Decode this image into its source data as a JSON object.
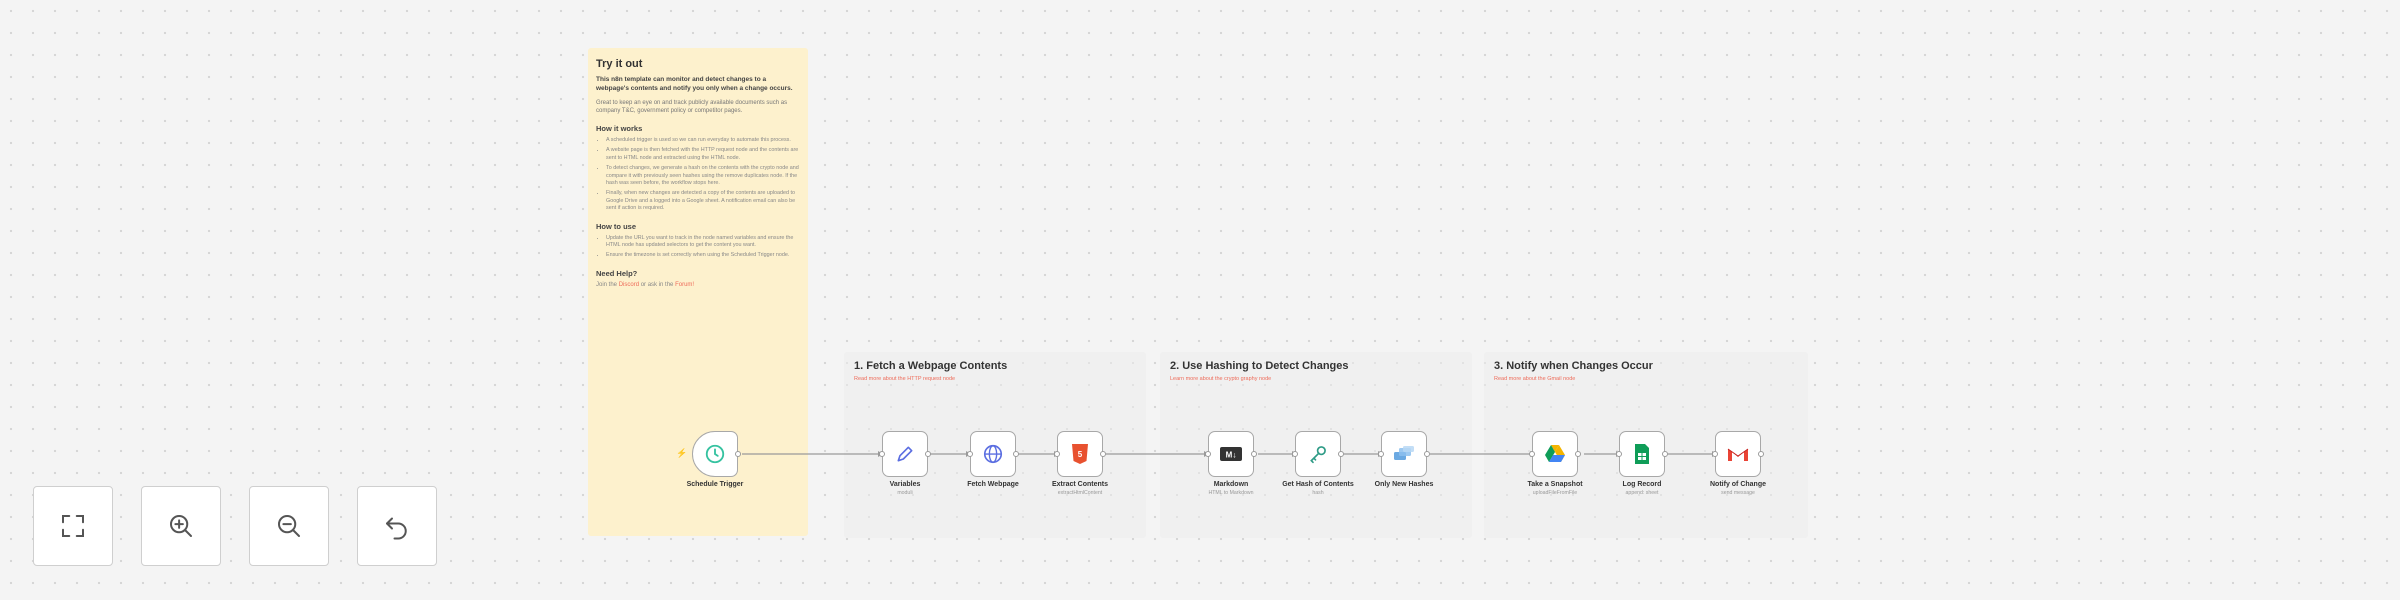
{
  "note": {
    "title": "Try it out",
    "lead": "This n8n template can monitor and detect changes to a webpage's contents and notify you only when a change occurs.",
    "intro": "Great to keep an eye on and track publicly available documents such as company T&C, government policy or competitor pages.",
    "how_works_heading": "How it works",
    "how_works_items": [
      "A scheduled trigger is used so we can run everyday to automate this process.",
      "A website page is then fetched with the HTTP request node and the contents are sent to HTML node and extracted using the HTML node.",
      "To detect changes, we generate a hash on the contents with the crypto node and compare it with previously seen hashes using the remove duplicates node. If the hash was seen before, the workflow stops here.",
      "Finally, when new changes are detected a copy of the contents are uploaded to Google Drive and a logged into a Google sheet. A notification email can also be sent if action is required."
    ],
    "how_use_heading": "How to use",
    "how_use_items": [
      "Update the URL you want to track in the node named variables and ensure the HTML node has updated selectors to get the content you want.",
      "Ensure the timezone is set correctly when using the Scheduled Trigger node."
    ],
    "help_heading": "Need Help?",
    "help_pre": "Join the",
    "help_link1": "Discord",
    "help_mid": "or ask in the",
    "help_link2": "Forum!"
  },
  "sections": [
    {
      "title": "1. Fetch a Webpage Contents",
      "subtitle": "Read more about the HTTP request node"
    },
    {
      "title": "2. Use Hashing to Detect Changes",
      "subtitle": "Learn more about the crypto graphy node"
    },
    {
      "title": "3. Notify when Changes Occur",
      "subtitle": "Read more about the Gmail node"
    }
  ],
  "nodes": [
    {
      "label": "Schedule Trigger",
      "sub": "",
      "icon": "clock-icon"
    },
    {
      "label": "Variables",
      "sub": "moduli",
      "icon": "pencil-icon"
    },
    {
      "label": "Fetch Webpage",
      "sub": "",
      "icon": "globe-icon"
    },
    {
      "label": "Extract Contents",
      "sub": "extractHtmlContent",
      "icon": "html-icon"
    },
    {
      "label": "Markdown",
      "sub": "HTML to Markdown",
      "icon": "markdown-icon"
    },
    {
      "label": "Get Hash of Contents",
      "sub": "hash",
      "icon": "key-icon"
    },
    {
      "label": "Only New Hashes",
      "sub": "",
      "icon": "dedupe-icon"
    },
    {
      "label": "Take a Snapshot",
      "sub": "uploadFileFromFile",
      "icon": "google-drive-icon"
    },
    {
      "label": "Log Record",
      "sub": "append: sheet",
      "icon": "google-sheets-icon"
    },
    {
      "label": "Notify of Change",
      "sub": "send message",
      "icon": "gmail-icon"
    }
  ],
  "controls": [
    {
      "name": "fit-view-button",
      "icon": "fullscreen-icon"
    },
    {
      "name": "zoom-in-button",
      "icon": "zoom-in-icon"
    },
    {
      "name": "zoom-out-button",
      "icon": "zoom-out-icon"
    },
    {
      "name": "undo-button",
      "icon": "undo-icon"
    }
  ],
  "colors": {
    "note_bg": "#fdf1cd",
    "link": "#ee6c5a",
    "trigger_green": "#35c2a0",
    "http_blue": "#5b6ee1",
    "html_red": "#e8512f"
  }
}
